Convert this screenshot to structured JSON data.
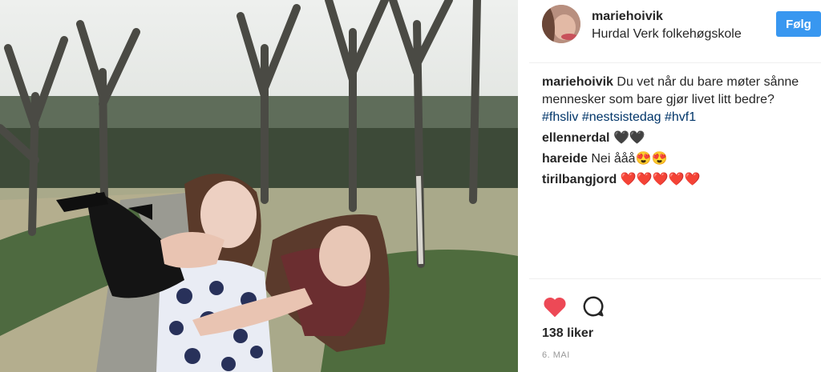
{
  "post": {
    "username": "mariehoivik",
    "location": "Hurdal Verk folkehøgskole",
    "follow_label": "Følg",
    "caption_user": "mariehoivik",
    "caption_text": "Du vet når du bare møter sånne mennesker som bare gjør livet litt bedre?",
    "hashtags": [
      "#fhsliv",
      "#nestsistedag",
      "#hvf1"
    ],
    "comments": [
      {
        "user": "ellennerdal",
        "text": "🖤🖤"
      },
      {
        "user": "hareide",
        "text": "Nei ååå😍😍"
      },
      {
        "user": "tirilbangjord",
        "text": "❤️❤️❤️❤️❤️"
      }
    ],
    "likes": "138 liker",
    "date": "6. MAI"
  },
  "icons": {
    "like": "heart-icon",
    "comment": "comment-icon",
    "like_color": "#ed4956"
  }
}
